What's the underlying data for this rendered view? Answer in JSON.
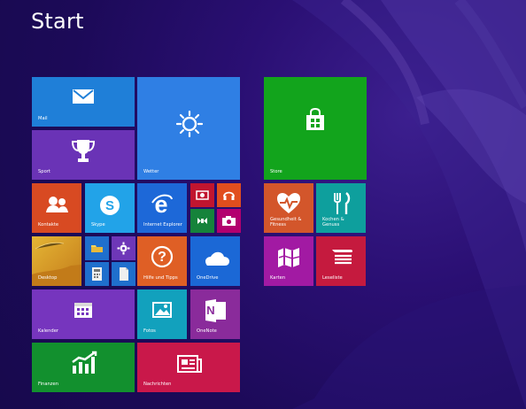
{
  "header": {
    "title": "Start"
  },
  "tiles": {
    "mail": {
      "label": "Mail",
      "icon": "mail-icon",
      "color": "#1f7fd8"
    },
    "weather": {
      "label": "Wetter",
      "icon": "sun-icon",
      "color": "#2f7fe4"
    },
    "sport": {
      "label": "Sport",
      "icon": "trophy-icon",
      "color": "#6a33b6"
    },
    "contacts": {
      "label": "Kontakte",
      "icon": "people-icon",
      "color": "#d84a22"
    },
    "skype": {
      "label": "Skype",
      "icon": "skype-icon",
      "color": "#22a3e8"
    },
    "internet_explorer": {
      "label": "Internet Explorer",
      "icon": "internet-explorer-icon",
      "color": "#1d68d8"
    },
    "video": {
      "label": "",
      "icon": "video-icon",
      "color": "#c1152f"
    },
    "music": {
      "label": "",
      "icon": "headphones-icon",
      "color": "#e14e1e"
    },
    "games": {
      "label": "",
      "icon": "controller-icon",
      "color": "#16833b"
    },
    "camera": {
      "label": "",
      "icon": "camera-icon",
      "color": "#b3006f"
    },
    "desktop": {
      "label": "Desktop",
      "icon": "desktop-wallpaper-icon",
      "color": "#d8a12b"
    },
    "pc_settings": {
      "label": "",
      "icon": "gear-icon",
      "color": "#6e37b8"
    },
    "file_explorer": {
      "label": "",
      "icon": "folder-icon",
      "color": "#1f6fcd"
    },
    "calculator": {
      "label": "",
      "icon": "calculator-icon",
      "color": "#1f6fcd"
    },
    "help_tips": {
      "label": "Hilfe und Tipps",
      "icon": "question-icon",
      "color": "#df5f25"
    },
    "onedrive": {
      "label": "OneDrive",
      "icon": "cloud-icon",
      "color": "#1b68d6"
    },
    "calendar": {
      "label": "Kalender",
      "icon": "calendar-icon",
      "color": "#7635be"
    },
    "photos": {
      "label": "Fotos",
      "icon": "photo-icon",
      "color": "#12a1bd"
    },
    "onenote": {
      "label": "OneNote",
      "icon": "onenote-icon",
      "color": "#8a2b9b"
    },
    "finance": {
      "label": "Finanzen",
      "icon": "finance-chart-icon",
      "color": "#12902e"
    },
    "news": {
      "label": "Nachrichten",
      "icon": "news-icon",
      "color": "#c9184a"
    },
    "store": {
      "label": "Store",
      "icon": "store-bag-icon",
      "color": "#12a41c"
    },
    "health": {
      "label": "Gesundheit & Fitness",
      "icon": "heartbeat-icon",
      "color": "#d3562b"
    },
    "food": {
      "label": "Kochen & Genuss",
      "icon": "fork-knife-icon",
      "color": "#0e9f9d"
    },
    "maps": {
      "label": "Karten",
      "icon": "map-icon",
      "color": "#a21aa3"
    },
    "reading_list": {
      "label": "Leseliste",
      "icon": "reading-list-icon",
      "color": "#c51a3e"
    }
  }
}
